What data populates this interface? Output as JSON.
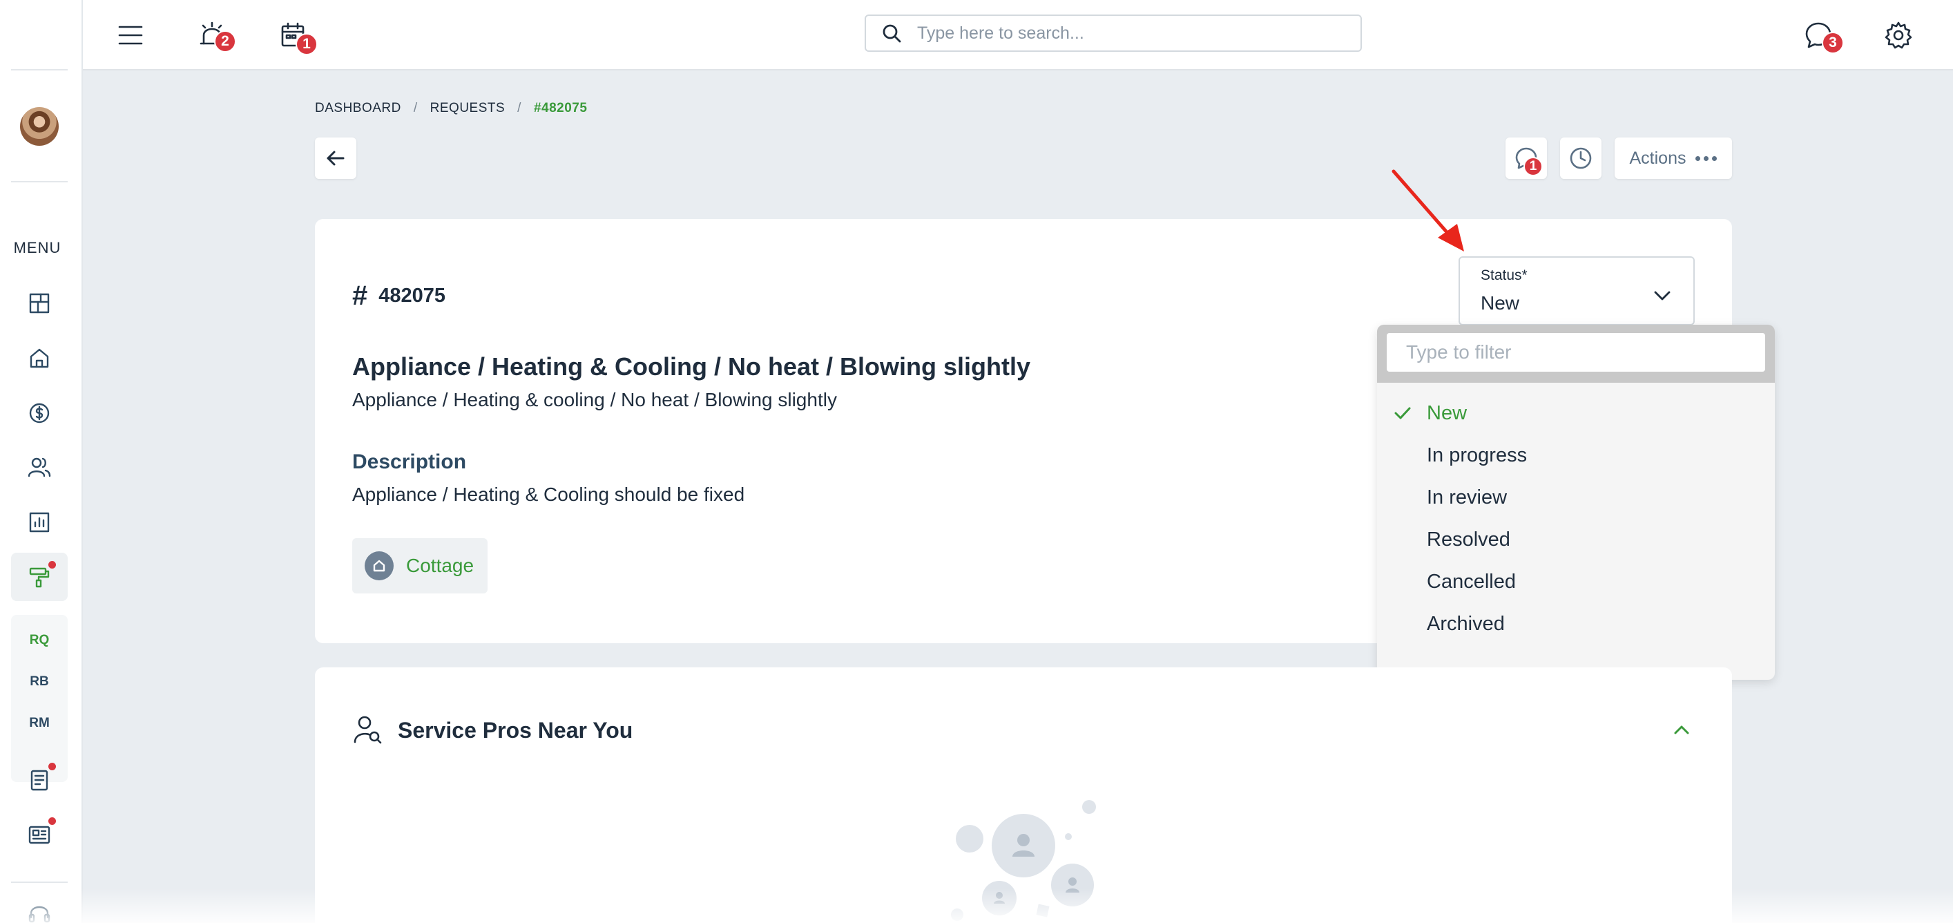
{
  "sidebar": {
    "menu_label": "MENU",
    "icons": [
      "dashboard-icon",
      "home-icon",
      "dollar-icon",
      "users-icon",
      "report-icon",
      "paint-roller-icon",
      "document-icon",
      "newspaper-icon",
      "headset-icon"
    ],
    "sub_items": [
      "RQ",
      "RB",
      "RM"
    ],
    "active_sub_item": "RQ"
  },
  "topbar": {
    "notifications_badge": "2",
    "calendar_badge": "1",
    "messages_badge": "3",
    "search_placeholder": "Type here to search..."
  },
  "breadcrumb": {
    "items": [
      "DASHBOARD",
      "REQUESTS"
    ],
    "current": "#482075",
    "separator": "/"
  },
  "header_actions": {
    "chat_badge": "1",
    "actions_label": "Actions"
  },
  "request": {
    "number": "482075",
    "title": "Appliance / Heating & Cooling / No heat / Blowing slightly",
    "subtitle": "Appliance / Heating & cooling / No heat / Blowing slightly",
    "description_label": "Description",
    "description": "Appliance / Heating & Cooling should be fixed",
    "property_tag": "Cottage"
  },
  "status": {
    "label": "Status*",
    "value": "New",
    "filter_placeholder": "Type to filter",
    "options": [
      "New",
      "In progress",
      "In review",
      "Resolved",
      "Cancelled",
      "Archived"
    ],
    "selected": "New"
  },
  "service_pros": {
    "title": "Service Pros Near You"
  },
  "colors": {
    "accent_green": "#3a9a3a",
    "badge_red": "#d9363e",
    "annotation_red": "#e8261c"
  }
}
